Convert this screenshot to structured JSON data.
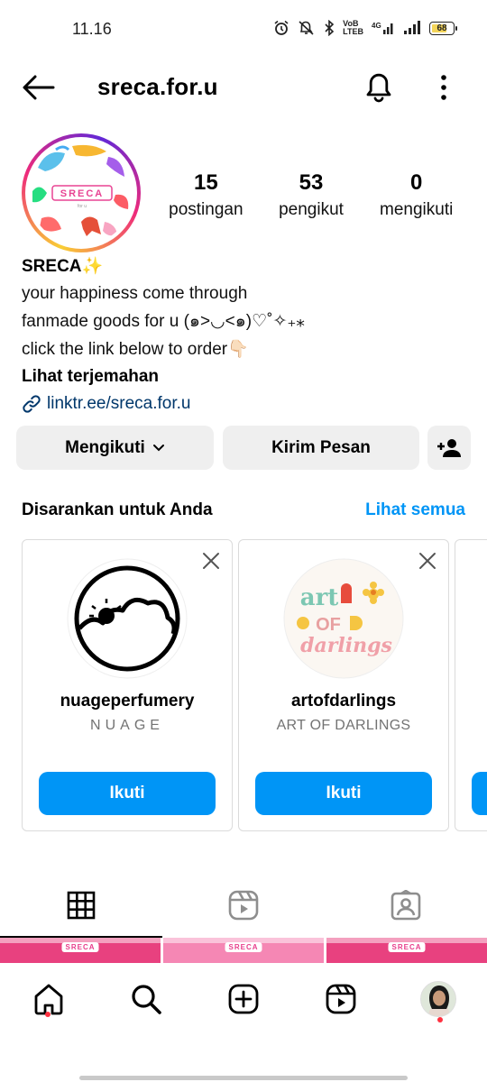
{
  "status_bar": {
    "time": "11.16",
    "network_label_1": "VoB",
    "network_label_2": "LTEB",
    "signal_label": "4G",
    "battery": "68"
  },
  "header": {
    "username": "sreca.for.u"
  },
  "profile": {
    "avatar_logo_text": "SRECA",
    "stats": [
      {
        "value": "15",
        "label": "postingan"
      },
      {
        "value": "53",
        "label": "pengikut"
      },
      {
        "value": "0",
        "label": "mengikuti"
      }
    ],
    "display_name": "SRECA✨",
    "bio_lines": [
      "your happiness come through",
      "fanmade goods for u (๑>◡<๑)♡˚✧₊⁎",
      "click the link below to order👇🏻"
    ],
    "translate_label": "Lihat terjemahan",
    "link": "linktr.ee/sreca.for.u"
  },
  "actions": {
    "following_label": "Mengikuti",
    "message_label": "Kirim Pesan"
  },
  "suggestions": {
    "title": "Disarankan untuk Anda",
    "see_all": "Lihat semua",
    "cards": [
      {
        "username": "nuageperfumery",
        "full_name": "NUAGE",
        "button": "Ikuti"
      },
      {
        "username": "artofdarlings",
        "full_name": "ART OF DARLINGS",
        "button": "Ikuti",
        "logo_line1": "art",
        "logo_line2": "OF",
        "logo_line3": "darlings"
      }
    ]
  },
  "thumbnails": {
    "logo_text": "SRECA"
  },
  "colors": {
    "accent_blue": "#0095f6",
    "link_blue": "#00376b",
    "button_gray": "#efefef",
    "notification_red": "#ff3040"
  },
  "icons": {
    "back": "arrow-left-icon",
    "bell": "bell-icon",
    "more": "more-vertical-icon",
    "link": "link-icon",
    "add_user": "add-user-icon",
    "grid": "grid-icon",
    "reels": "reels-icon",
    "tagged": "tagged-icon",
    "home": "home-icon",
    "search": "search-icon",
    "create": "create-icon"
  }
}
